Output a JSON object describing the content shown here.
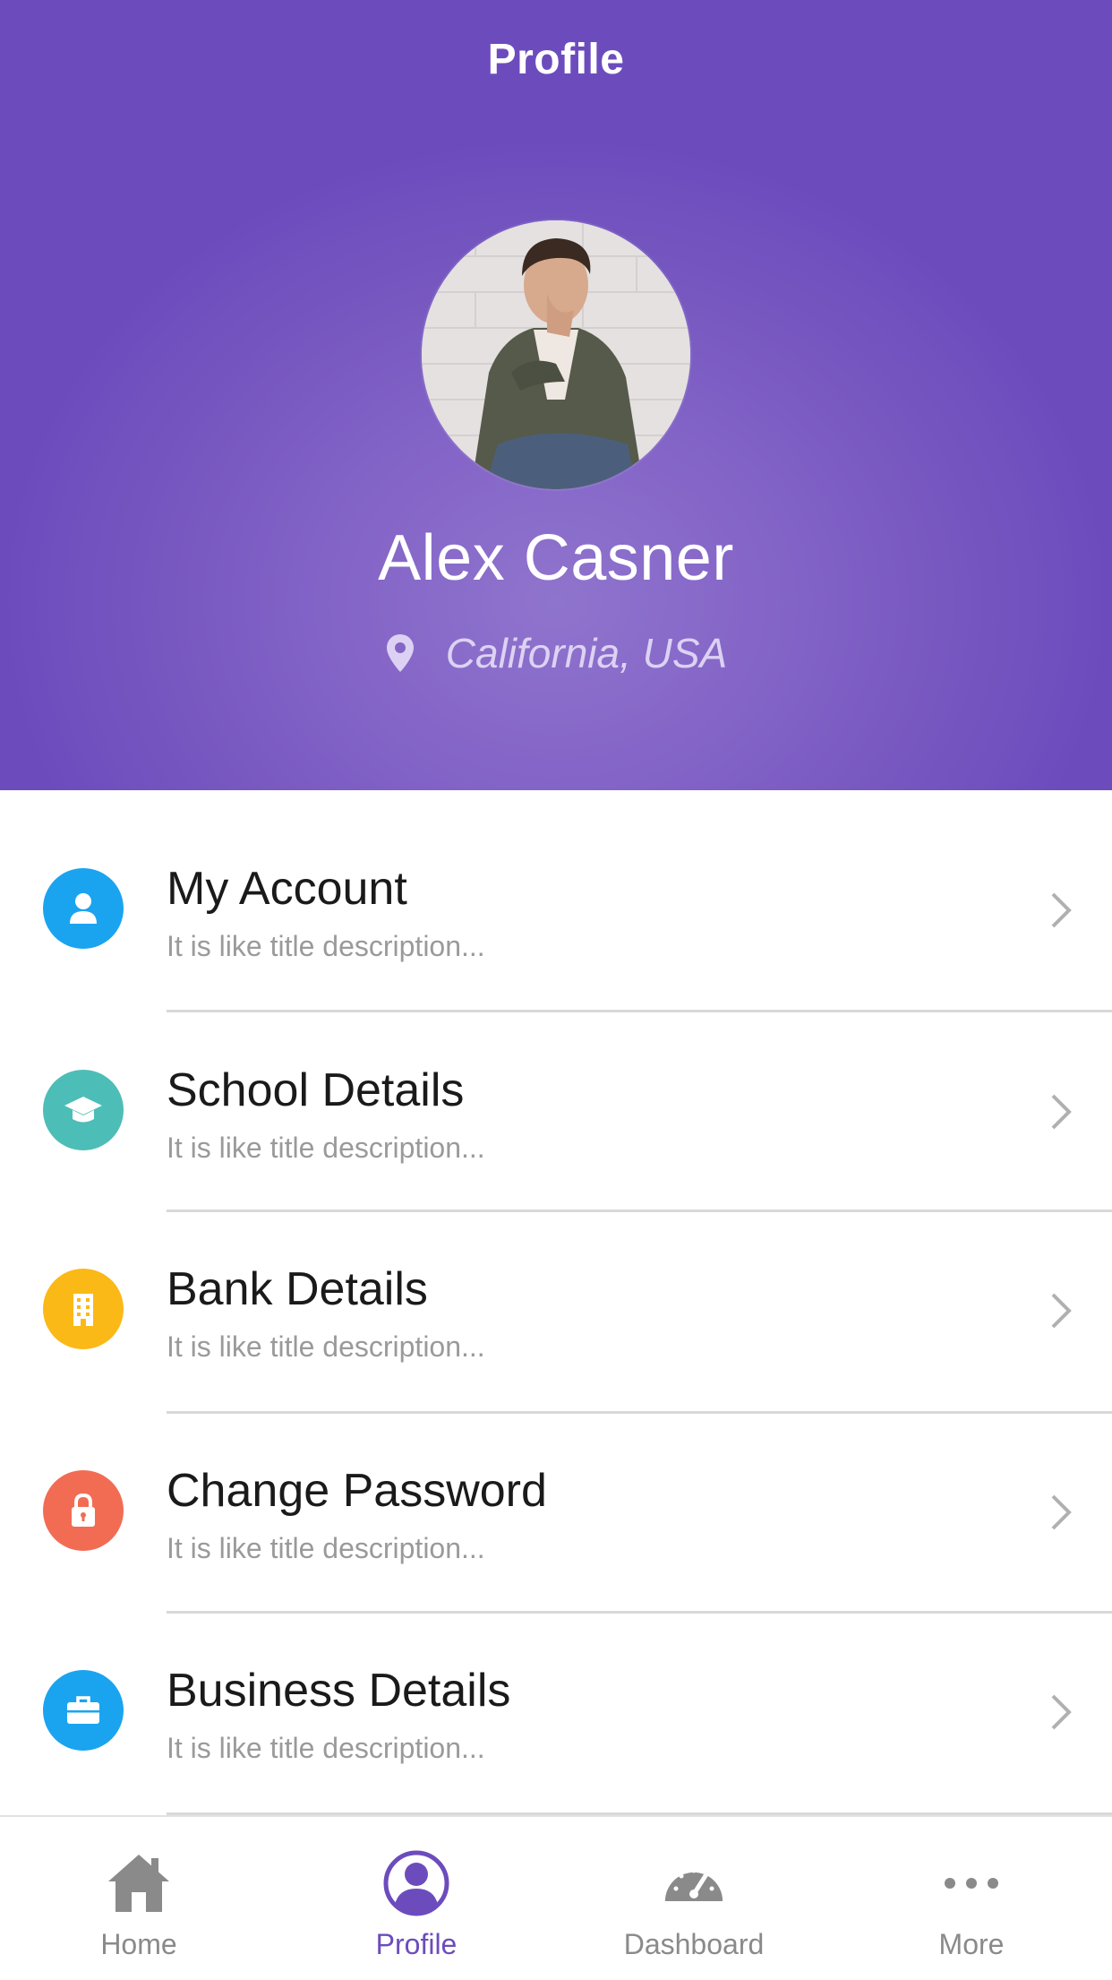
{
  "header": {
    "title": "Profile"
  },
  "profile": {
    "name": "Alex Casner",
    "location": "California, USA",
    "avatar_icon": "user-photo"
  },
  "menu": [
    {
      "title": "My Account",
      "description": "It is like title description...",
      "icon": "user-icon",
      "color": "#1aa4f0"
    },
    {
      "title": "School Details",
      "description": "It is like title description...",
      "icon": "graduation-cap-icon",
      "color": "#4dbdb7"
    },
    {
      "title": "Bank Details",
      "description": "It is like title description...",
      "icon": "building-icon",
      "color": "#fbb917"
    },
    {
      "title": "Change Password",
      "description": "It is like title description...",
      "icon": "lock-icon",
      "color": "#f26c54"
    },
    {
      "title": "Business Details",
      "description": "It is like title description...",
      "icon": "briefcase-icon",
      "color": "#1aa4f0"
    }
  ],
  "tabbar": {
    "tabs": [
      {
        "label": "Home",
        "icon": "home-icon",
        "active": false
      },
      {
        "label": "Profile",
        "icon": "profile-icon",
        "active": true
      },
      {
        "label": "Dashboard",
        "icon": "speedometer-icon",
        "active": false
      },
      {
        "label": "More",
        "icon": "more-dots-icon",
        "active": false
      }
    ]
  },
  "colors": {
    "primary": "#6c4cbd",
    "text": "#1a1a1a",
    "muted": "#9a9a9a",
    "inactive_tab": "#8a8a8a"
  }
}
